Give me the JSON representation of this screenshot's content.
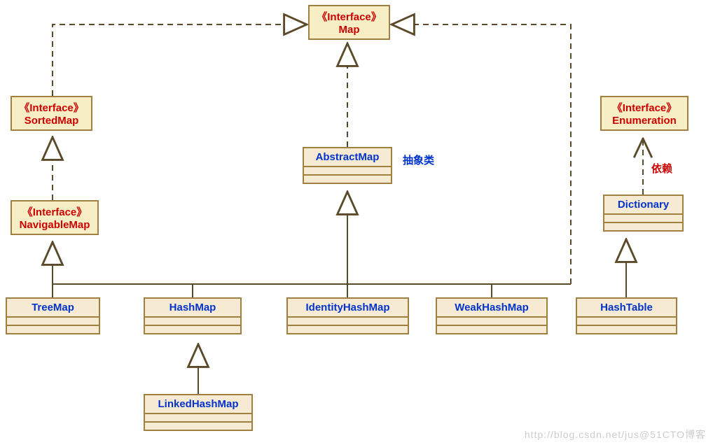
{
  "stereotype": {
    "interface": "《Interface》"
  },
  "nodes": {
    "map": {
      "name": "Map"
    },
    "sortedMap": {
      "name": "SortedMap"
    },
    "navigableMap": {
      "name": "NavigableMap"
    },
    "enumeration": {
      "name": "Enumeration"
    },
    "abstractMap": {
      "name": "AbstractMap"
    },
    "dictionary": {
      "name": "Dictionary"
    },
    "treeMap": {
      "name": "TreeMap"
    },
    "hashMap": {
      "name": "HashMap"
    },
    "identityHashMap": {
      "name": "IdentityHashMap"
    },
    "weakHashMap": {
      "name": "WeakHashMap"
    },
    "hashTable": {
      "name": "HashTable"
    },
    "linkedHashMap": {
      "name": "LinkedHashMap"
    }
  },
  "labels": {
    "abstractClass": "抽象类",
    "dependency": "依赖"
  },
  "watermark": "http://blog.csdn.net/jus@51CTO博客"
}
